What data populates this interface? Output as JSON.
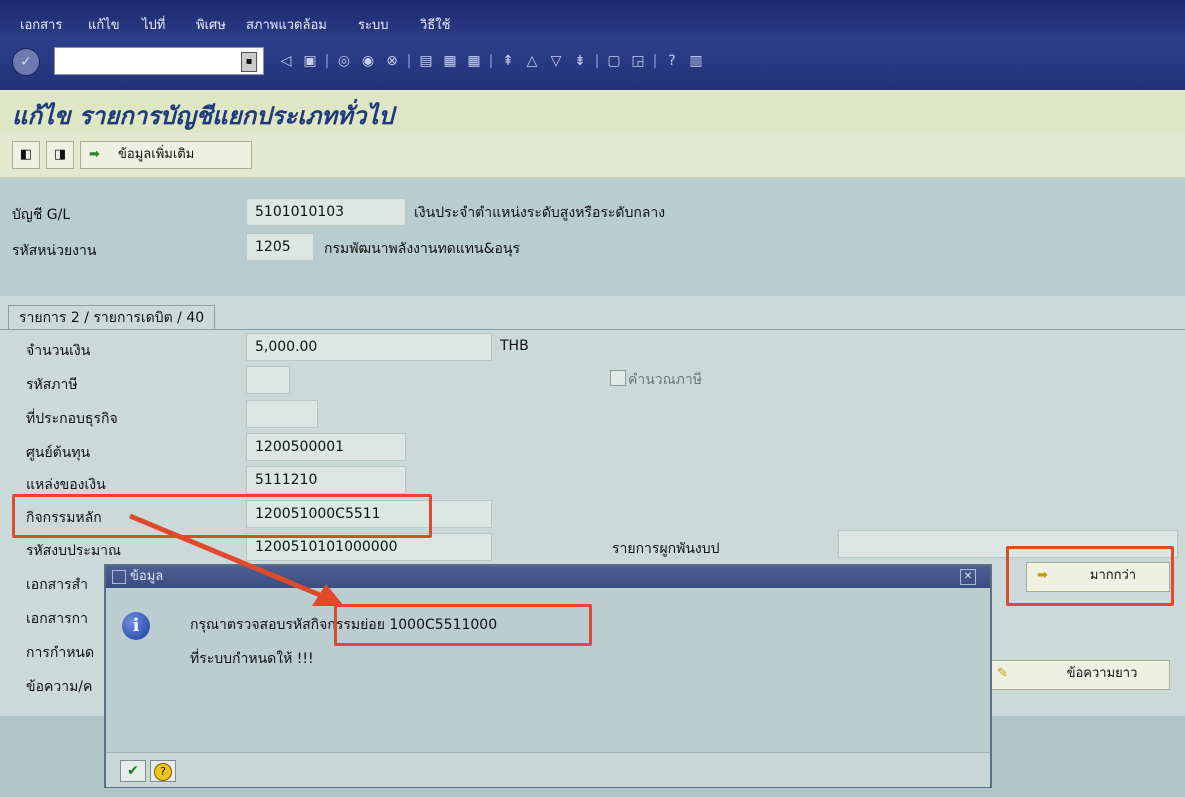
{
  "menu": [
    "เอกสาร",
    "แก้ไข",
    "ไปที่",
    "พิเศษ",
    "สภาพแวดล้อม",
    "ระบบ",
    "วิธีใช้"
  ],
  "toolbar": {
    "command_value": "",
    "icons": [
      "back-icon",
      "save-icon",
      "nav-back-icon",
      "exit-icon",
      "cancel-icon",
      "print-icon",
      "find-icon",
      "find-next-icon",
      "first-page-icon",
      "prev-page-icon",
      "next-page-icon",
      "last-page-icon",
      "new-session-icon",
      "shortcut-icon",
      "help-icon",
      "layout-icon"
    ]
  },
  "page_title": "แก้ไข รายการบัญชีแยกประเภททั่วไป",
  "appbar": {
    "more_data_label": "ข้อมูลเพิ่มเติม"
  },
  "header": {
    "gl_label": "บัญชี G/L",
    "gl_value": "5101010103",
    "gl_desc": "เงินประจำตำแหน่งระดับสูงหรือระดับกลาง",
    "unit_label": "รหัสหน่วยงาน",
    "unit_value": "1205",
    "unit_desc": "กรมพัฒนาพลังงานทดแทน&อนุร"
  },
  "tab": {
    "caption": "รายการ 2 / รายการเดบิต / 40"
  },
  "fields": {
    "amount_label": "จำนวนเงิน",
    "amount_value": "5,000.00",
    "currency": "THB",
    "tax_code_label": "รหัสภาษี",
    "tax_code_value": "",
    "calc_tax_label": "คำนวณภาษี",
    "business_place_label": "ที่ประกอบธุรกิจ",
    "business_place_value": "",
    "cost_center_label": "ศูนย์ต้นทุน",
    "cost_center_value": "1200500001",
    "fund_label": "แหล่งของเงิน",
    "fund_value": "5111210",
    "main_activity_label": "กิจกรรมหลัก",
    "main_activity_value": "120051000C5511",
    "budget_code_label": "รหัสงบประมาณ",
    "budget_code_value": "1200510101000000",
    "commitment_label": "รายการผูกพันงบป",
    "commitment_value": "",
    "doc_ref1_label": "เอกสารสำ",
    "doc_ref2_label": "เอกสารกา",
    "assignment_label": "การกำหนด",
    "text_label": "ข้อความ/ค"
  },
  "buttons": {
    "more_label": "มากกว่า",
    "long_text_label": "ข้อความยาว"
  },
  "dialog": {
    "title": "ข้อมูล",
    "line1_prefix": "กรุณาตรวจสอบรหัส",
    "line1_highlight": "กิจกรรมย่อย 1000C5511000",
    "line2": "ที่ระบบกำหนดให้ !!!",
    "ok_symbol": "✔",
    "help_symbol": "?"
  }
}
